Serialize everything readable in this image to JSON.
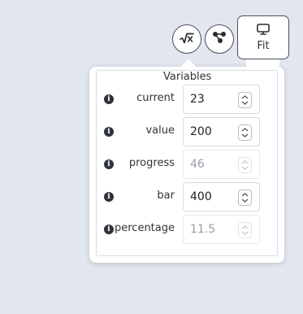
{
  "toolbar": {
    "formula_icon": "square-root-icon",
    "graph_icon": "graph-nodes-icon",
    "fit_icon": "monitor-icon",
    "fit_label": "Fit"
  },
  "variables_panel": {
    "title": "Variables",
    "rows": [
      {
        "label": "current",
        "value": "23",
        "editable": true
      },
      {
        "label": "value",
        "value": "200",
        "editable": true
      },
      {
        "label": "progress",
        "value": "46",
        "editable": false
      },
      {
        "label": "bar",
        "value": "400",
        "editable": true
      },
      {
        "label": "percentage",
        "value": "11.5",
        "editable": false
      }
    ]
  },
  "colors": {
    "background": "#e1e6ef",
    "border_dark": "#4a4f5a",
    "disabled_text": "#9a9ea6"
  }
}
